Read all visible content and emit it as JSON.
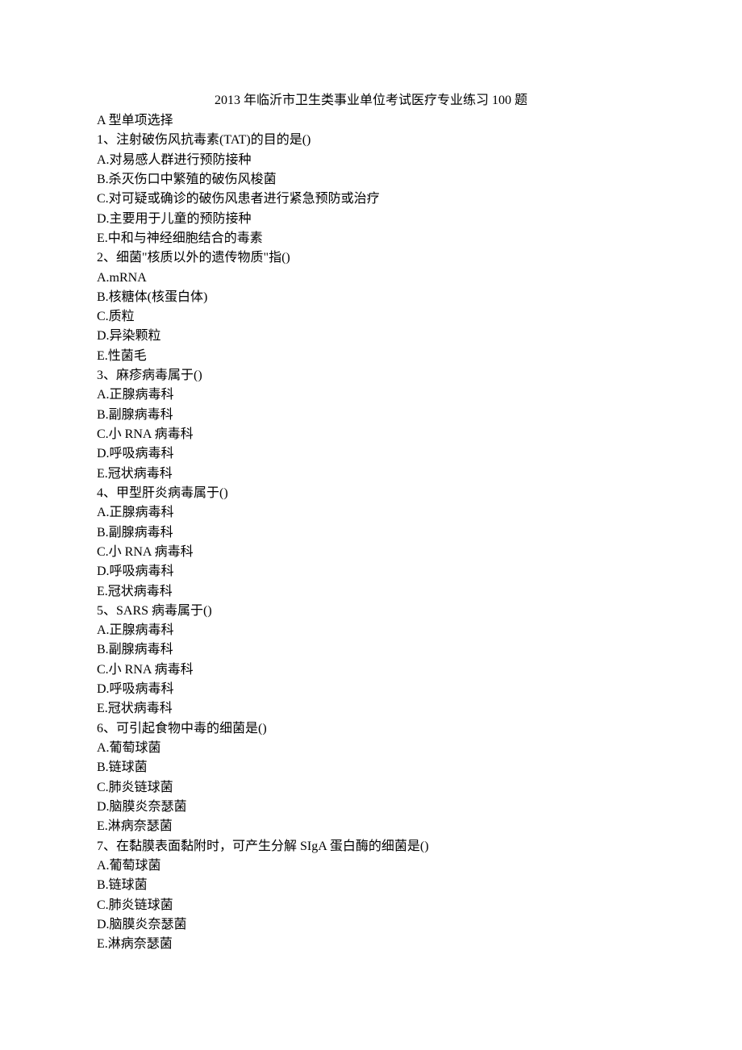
{
  "title": "2013 年临沂市卫生类事业单位考试医疗专业练习 100 题",
  "section": "A 型单项选择",
  "questions": [
    {
      "stem": "1、注射破伤风抗毒素(TAT)的目的是()",
      "options": [
        "A.对易感人群进行预防接种",
        "B.杀灭伤口中繁殖的破伤风梭菌",
        "C.对可疑或确诊的破伤风患者进行紧急预防或治疗",
        "D.主要用于儿童的预防接种",
        "E.中和与神经细胞结合的毒素"
      ]
    },
    {
      "stem": "2、细菌\"核质以外的遗传物质\"指()",
      "options": [
        "A.mRNA",
        "B.核糖体(核蛋白体)",
        "C.质粒",
        "D.异染颗粒",
        "E.性菌毛"
      ]
    },
    {
      "stem": "3、麻疹病毒属于()",
      "options": [
        "A.正腺病毒科",
        "B.副腺病毒科",
        "C.小 RNA 病毒科",
        "D.呼吸病毒科",
        "E.冠状病毒科"
      ]
    },
    {
      "stem": "4、甲型肝炎病毒属于()",
      "options": [
        "A.正腺病毒科",
        "B.副腺病毒科",
        "C.小 RNA 病毒科",
        "D.呼吸病毒科",
        "E.冠状病毒科"
      ]
    },
    {
      "stem": "5、SARS 病毒属于()",
      "options": [
        "A.正腺病毒科",
        "B.副腺病毒科",
        "C.小 RNA 病毒科",
        "D.呼吸病毒科",
        "E.冠状病毒科"
      ]
    },
    {
      "stem": "6、可引起食物中毒的细菌是()",
      "options": [
        "A.葡萄球菌",
        "B.链球菌",
        "C.肺炎链球菌",
        "D.脑膜炎奈瑟菌",
        "E.淋病奈瑟菌"
      ]
    },
    {
      "stem": "7、在黏膜表面黏附时，可产生分解 SIgA 蛋白酶的细菌是()",
      "options": [
        "A.葡萄球菌",
        "B.链球菌",
        "C.肺炎链球菌",
        "D.脑膜炎奈瑟菌",
        "E.淋病奈瑟菌"
      ]
    }
  ]
}
